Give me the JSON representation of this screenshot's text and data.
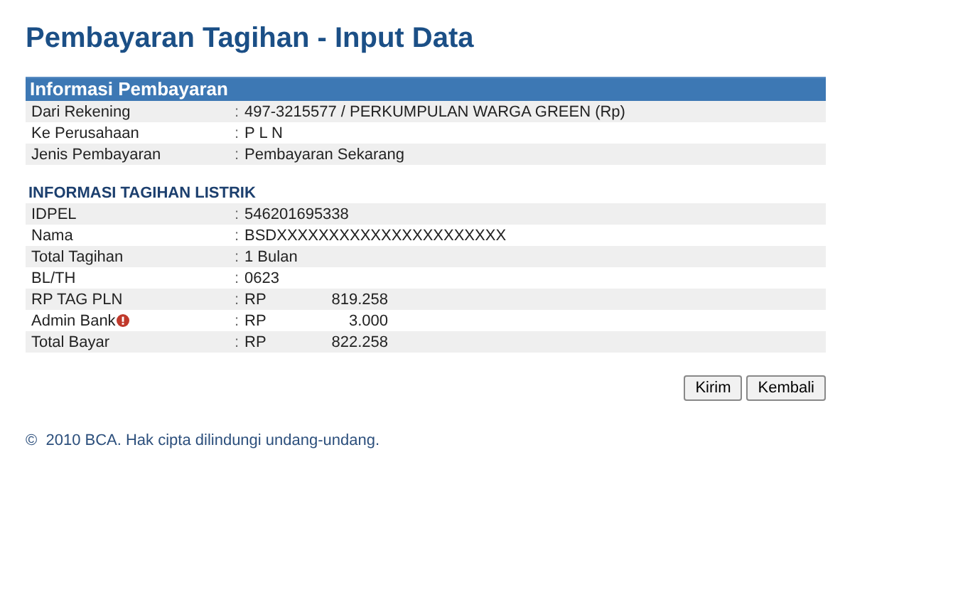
{
  "title": "Pembayaran Tagihan - Input Data",
  "payment_info": {
    "heading": "Informasi Pembayaran",
    "rows": [
      {
        "label": "Dari Rekening",
        "separator": ":",
        "value": "497-3215577 / PERKUMPULAN WARGA GREEN (Rp)"
      },
      {
        "label": "Ke Perusahaan",
        "separator": ":",
        "value": "P L N"
      },
      {
        "label": "Jenis Pembayaran",
        "separator": ":",
        "value": "Pembayaran Sekarang"
      }
    ]
  },
  "bill_info": {
    "heading": "INFORMASI TAGIHAN LISTRIK",
    "rows": [
      {
        "kind": "text",
        "label": "IDPEL",
        "separator": ":",
        "value": "546201695338"
      },
      {
        "kind": "text",
        "label": "Nama",
        "separator": ":",
        "value": "BSDXXXXXXXXXXXXXXXXXXXXXX"
      },
      {
        "kind": "text",
        "label": "Total Tagihan",
        "separator": ":",
        "value": "1 Bulan"
      },
      {
        "kind": "text",
        "label": "BL/TH",
        "separator": ":",
        "value": "0623"
      },
      {
        "kind": "amount",
        "label": "RP TAG PLN",
        "separator": ":",
        "currency": "RP",
        "value": "819.258"
      },
      {
        "kind": "amount",
        "label": "Admin Bank",
        "info_icon": true,
        "separator": ":",
        "currency": "RP",
        "value": "3.000"
      },
      {
        "kind": "amount",
        "label": "Total Bayar",
        "separator": ":",
        "currency": "RP",
        "value": "822.258"
      }
    ]
  },
  "buttons": [
    "Kirim",
    "Kembali"
  ],
  "footer": "©  2010 BCA. Hak cipta dilindungi undang-undang."
}
